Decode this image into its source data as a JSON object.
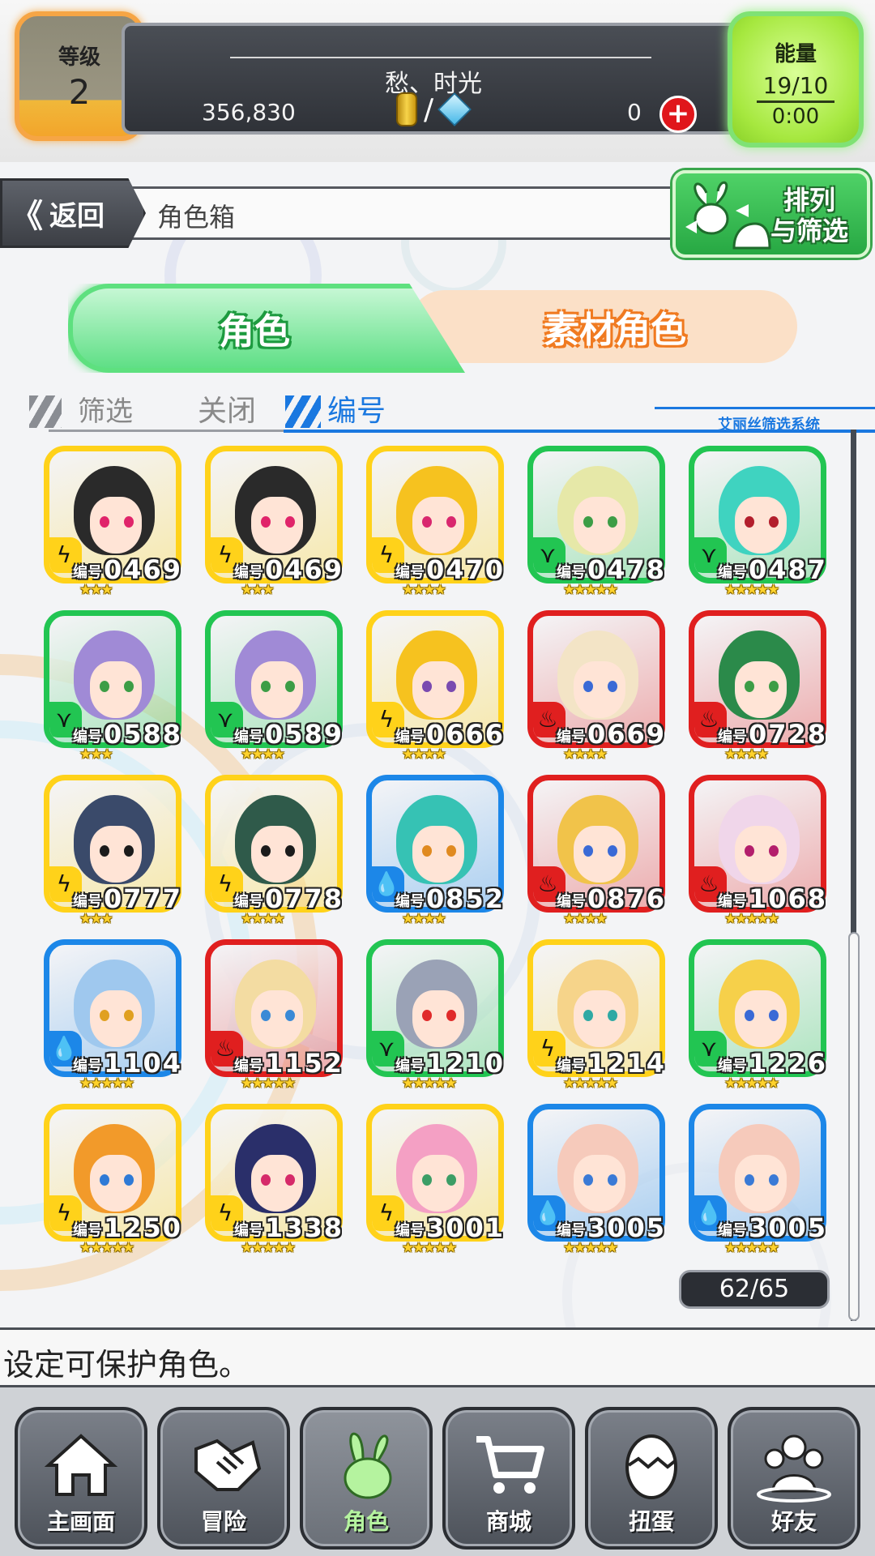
{
  "status": {
    "level_label": "等级",
    "level_value": "2",
    "player_name": "愁、时光",
    "gold": "356,830",
    "slash": "/",
    "gems": "0",
    "energy_label": "能量",
    "energy_value": "19/10",
    "energy_timer": "0:00"
  },
  "nav": {
    "back_label": "返回",
    "back_chevrons": "《",
    "page_title": "角色箱",
    "sort_label_line1": "排列",
    "sort_label_line2": "与筛选"
  },
  "tabs": {
    "character": "角色",
    "material": "素材角色"
  },
  "filter": {
    "filter_label": "筛选",
    "filter_state": "关闭",
    "sort_key": "编号",
    "system_name": "艾丽丝筛选系统"
  },
  "card_number_label": "编号",
  "colors": {
    "yellow": "#ffd21a",
    "green": "#22c552",
    "red": "#e01f1f",
    "blue": "#1c87e8"
  },
  "characters": [
    {
      "number": "0469",
      "frame": "yellow",
      "element": "lightning-icon",
      "stars": 3,
      "hair": "#2a2a2a",
      "eye": "#e0246a"
    },
    {
      "number": "0469",
      "frame": "yellow",
      "element": "lightning-icon",
      "stars": 3,
      "hair": "#2a2a2a",
      "eye": "#e0246a"
    },
    {
      "number": "0470",
      "frame": "yellow",
      "element": "lightning-icon",
      "stars": 4,
      "hair": "#f6c21f",
      "eye": "#d9276e"
    },
    {
      "number": "0478",
      "frame": "green",
      "element": "wind-icon",
      "stars": 5,
      "hair": "#e6e8a8",
      "eye": "#3c9d46"
    },
    {
      "number": "0487",
      "frame": "green",
      "element": "wind-icon",
      "stars": 5,
      "hair": "#3fd3c0",
      "eye": "#b31e2c"
    },
    {
      "number": "0588",
      "frame": "green",
      "element": "wind-icon",
      "stars": 3,
      "hair": "#a08ad6",
      "eye": "#3c9d46"
    },
    {
      "number": "0589",
      "frame": "green",
      "element": "wind-icon",
      "stars": 4,
      "hair": "#a08ad6",
      "eye": "#3c9d46"
    },
    {
      "number": "0666",
      "frame": "yellow",
      "element": "lightning-icon",
      "stars": 4,
      "hair": "#f6c21f",
      "eye": "#7a4ab0"
    },
    {
      "number": "0669",
      "frame": "red",
      "element": "fire-icon",
      "stars": 4,
      "hair": "#f3e4c6",
      "eye": "#3a6ad6"
    },
    {
      "number": "0728",
      "frame": "red",
      "element": "fire-icon",
      "stars": 4,
      "hair": "#2b8a4a",
      "eye": "#3c9d46"
    },
    {
      "number": "0777",
      "frame": "yellow",
      "element": "lightning-icon",
      "stars": 3,
      "hair": "#3a4a6a",
      "eye": "#1b1b1b"
    },
    {
      "number": "0778",
      "frame": "yellow",
      "element": "lightning-icon",
      "stars": 4,
      "hair": "#2f5a4a",
      "eye": "#1b1b1b"
    },
    {
      "number": "0852",
      "frame": "blue",
      "element": "water-icon",
      "stars": 4,
      "hair": "#36c2b4",
      "eye": "#e08a20"
    },
    {
      "number": "0876",
      "frame": "red",
      "element": "fire-icon",
      "stars": 4,
      "hair": "#f1c34a",
      "eye": "#3a6ad6"
    },
    {
      "number": "1068",
      "frame": "red",
      "element": "fire-icon",
      "stars": 5,
      "hair": "#f0d6ea",
      "eye": "#b31e6c"
    },
    {
      "number": "1104",
      "frame": "blue",
      "element": "water-icon",
      "stars": 5,
      "hair": "#9fc8ee",
      "eye": "#e0a020"
    },
    {
      "number": "1152",
      "frame": "red",
      "element": "fire-icon",
      "stars": 5,
      "hair": "#f3dca2",
      "eye": "#3a8ad6"
    },
    {
      "number": "1210",
      "frame": "green",
      "element": "wind-icon",
      "stars": 5,
      "hair": "#9aa2b6",
      "eye": "#e02a2a"
    },
    {
      "number": "1214",
      "frame": "yellow",
      "element": "lightning-icon",
      "stars": 5,
      "hair": "#f6d48a",
      "eye": "#2fa9a4"
    },
    {
      "number": "1226",
      "frame": "green",
      "element": "wind-icon",
      "stars": 5,
      "hair": "#f6d04a",
      "eye": "#3a6ad6"
    },
    {
      "number": "1250",
      "frame": "yellow",
      "element": "lightning-icon",
      "stars": 5,
      "hair": "#f29a2a",
      "eye": "#2f7ad6"
    },
    {
      "number": "1338",
      "frame": "yellow",
      "element": "lightning-icon",
      "stars": 5,
      "hair": "#2a2f6a",
      "eye": "#d62a6a"
    },
    {
      "number": "3001",
      "frame": "yellow",
      "element": "lightning-icon",
      "stars": 5,
      "hair": "#f4a0c4",
      "eye": "#3c9d66"
    },
    {
      "number": "3005",
      "frame": "blue",
      "element": "water-icon",
      "stars": 5,
      "hair": "#f6cabb",
      "eye": "#3a7ad6"
    },
    {
      "number": "3005",
      "frame": "blue",
      "element": "water-icon",
      "stars": 5,
      "hair": "#f6cabb",
      "eye": "#3a7ad6"
    }
  ],
  "box_count": "62/65",
  "help_text": "设定可保护角色。",
  "bottom_nav": [
    {
      "label": "主画面",
      "icon": "home-icon",
      "active": false
    },
    {
      "label": "冒险",
      "icon": "handshake-icon",
      "active": false
    },
    {
      "label": "角色",
      "icon": "rabbit-icon",
      "active": true
    },
    {
      "label": "商城",
      "icon": "cart-icon",
      "active": false
    },
    {
      "label": "扭蛋",
      "icon": "egg-icon",
      "active": false
    },
    {
      "label": "好友",
      "icon": "friends-icon",
      "active": false
    }
  ]
}
